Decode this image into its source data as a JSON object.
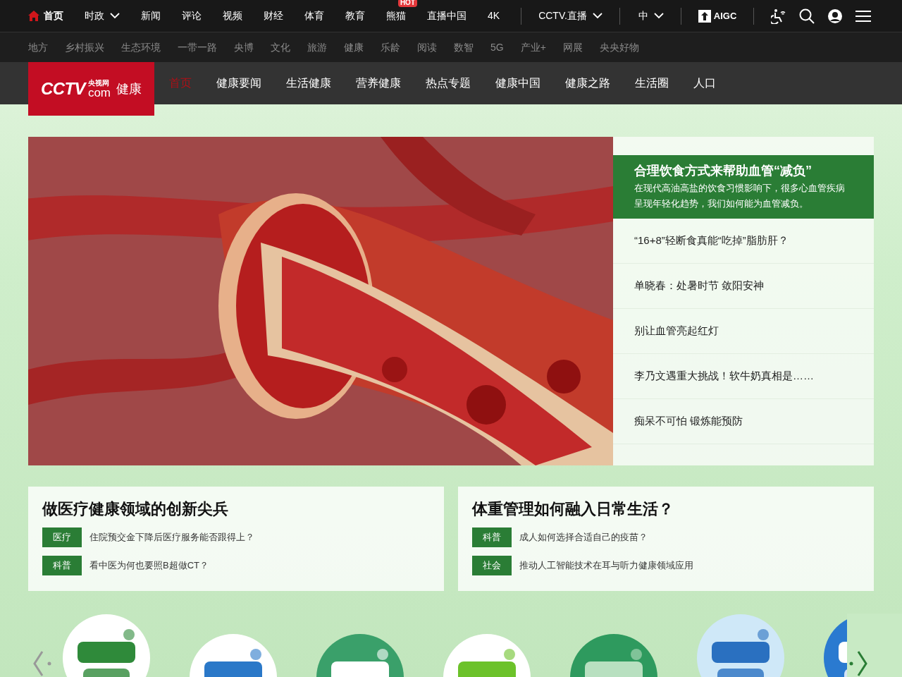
{
  "top_nav": {
    "items": [
      {
        "label": "首页",
        "kind": "home",
        "selected": true
      },
      {
        "label": "时政",
        "kind": "dropdown",
        "selected": false
      },
      {
        "label": "新闻",
        "kind": "link",
        "selected": false
      },
      {
        "label": "评论",
        "kind": "link",
        "selected": false
      },
      {
        "label": "视频",
        "kind": "link",
        "selected": false
      },
      {
        "label": "财经",
        "kind": "link",
        "selected": false
      },
      {
        "label": "体育",
        "kind": "link",
        "selected": false
      },
      {
        "label": "教育",
        "kind": "link",
        "selected": false
      },
      {
        "label": "熊猫",
        "kind": "link",
        "selected": false,
        "badge": "HOT"
      },
      {
        "label": "直播中国",
        "kind": "link",
        "selected": false
      },
      {
        "label": "4K",
        "kind": "link",
        "selected": false
      }
    ],
    "live": "CCTV.直播",
    "language": "中",
    "aigc": "AIGC"
  },
  "channel_nav": [
    "地方",
    "乡村振兴",
    "生态环境",
    "一带一路",
    "央博",
    "文化",
    "旅游",
    "健康",
    "乐龄",
    "阅读",
    "数智",
    "5G",
    "产业+",
    "网展",
    "央央好物"
  ],
  "site_nav": {
    "logo_text": "CCTV",
    "logo_sub": "央视网",
    "logo_com": "com",
    "section": "健康",
    "items": [
      {
        "label": "首页",
        "selected": true
      },
      {
        "label": "健康要闻",
        "selected": false
      },
      {
        "label": "生活健康",
        "selected": false
      },
      {
        "label": "营养健康",
        "selected": false
      },
      {
        "label": "热点专题",
        "selected": false
      },
      {
        "label": "健康中国",
        "selected": false
      },
      {
        "label": "健康之路",
        "selected": false
      },
      {
        "label": "生活圈",
        "selected": false
      },
      {
        "label": "人口",
        "selected": false
      }
    ]
  },
  "hero": {
    "kind": "picture",
    "headlines": [
      {
        "title": "合理饮食方式来帮助血管“减负”",
        "summary": "在现代高油高盐的饮食习惯影响下，很多心血管疾病呈现年轻化趋势，我们如何能为血管减负。",
        "selected": true
      },
      {
        "title": "“16+8”轻断食真能“吃掉”脂肪肝？",
        "selected": false
      },
      {
        "title": "单晓春：处暑时节 敛阳安神",
        "selected": false
      },
      {
        "title": "别让血管亮起红灯",
        "selected": false
      },
      {
        "title": "李乃文遇重大挑战！软牛奶真相是……",
        "selected": false
      },
      {
        "title": "痴呆不可怕 锻炼能预防",
        "selected": false
      }
    ]
  },
  "topic_cards": [
    {
      "title": "做医疗健康领域的创新尖兵",
      "items": [
        {
          "tag": "医疗",
          "text": "住院预交金下降后医疗服务能否跟得上？"
        },
        {
          "tag": "科普",
          "text": "看中医为何也要照B超做CT？"
        }
      ]
    },
    {
      "title": "体重管理如何融入日常生活？",
      "items": [
        {
          "tag": "科普",
          "text": "成人如何选择合适自己的疫苗？"
        },
        {
          "tag": "社会",
          "text": "推动人工智能技术在耳与听力健康领域应用"
        }
      ]
    }
  ]
}
